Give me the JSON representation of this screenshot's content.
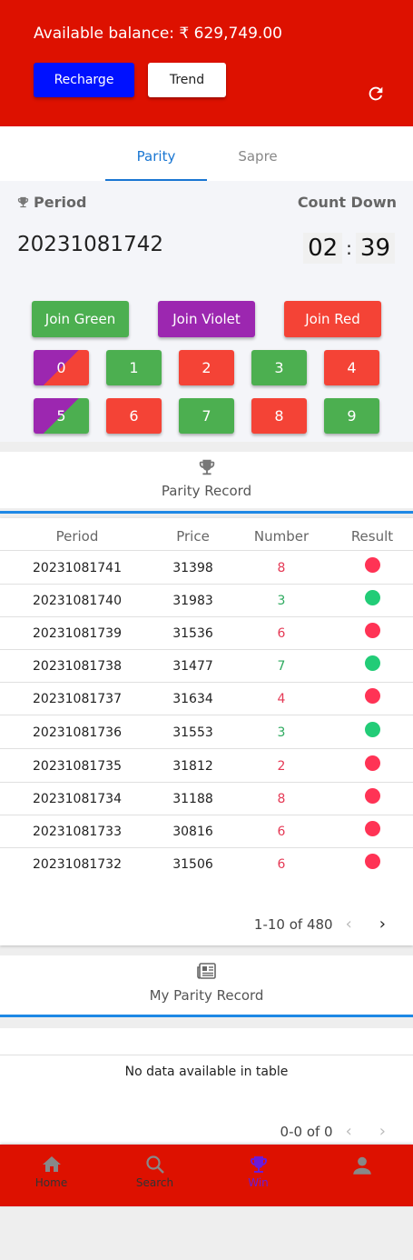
{
  "header": {
    "balance_label": "Available balance: ₹ 629,749.00",
    "recharge_label": "Recharge",
    "trend_label": "Trend"
  },
  "tabs": [
    {
      "label": "Parity",
      "active": true
    },
    {
      "label": "Sapre",
      "active": false
    }
  ],
  "game": {
    "period_label": "Period",
    "countdown_label": "Count Down",
    "period_number": "20231081742",
    "timer": {
      "minutes": "02",
      "seconds": "39",
      "sep": ":"
    },
    "join_green": "Join Green",
    "join_violet": "Join Violet",
    "join_red": "Join Red",
    "numbers": [
      "0",
      "1",
      "2",
      "3",
      "4",
      "5",
      "6",
      "7",
      "8",
      "9"
    ]
  },
  "parity_record": {
    "title": "Parity Record",
    "columns": [
      "Period",
      "Price",
      "Number",
      "Result"
    ],
    "rows": [
      {
        "period": "20231081741",
        "price": "31398",
        "number": "8",
        "result": "red"
      },
      {
        "period": "20231081740",
        "price": "31983",
        "number": "3",
        "result": "green"
      },
      {
        "period": "20231081739",
        "price": "31536",
        "number": "6",
        "result": "red"
      },
      {
        "period": "20231081738",
        "price": "31477",
        "number": "7",
        "result": "green"
      },
      {
        "period": "20231081737",
        "price": "31634",
        "number": "4",
        "result": "red"
      },
      {
        "period": "20231081736",
        "price": "31553",
        "number": "3",
        "result": "green"
      },
      {
        "period": "20231081735",
        "price": "31812",
        "number": "2",
        "result": "red"
      },
      {
        "period": "20231081734",
        "price": "31188",
        "number": "8",
        "result": "red"
      },
      {
        "period": "20231081733",
        "price": "30816",
        "number": "6",
        "result": "red"
      },
      {
        "period": "20231081732",
        "price": "31506",
        "number": "6",
        "result": "red"
      }
    ],
    "pagination": "1-10 of 480"
  },
  "my_record": {
    "title": "My Parity Record",
    "empty_text": "No data available in table",
    "pagination": "0-0 of 0"
  },
  "nav": [
    {
      "label": "Home",
      "icon": "home-icon"
    },
    {
      "label": "Search",
      "icon": "search-icon"
    },
    {
      "label": "Win",
      "icon": "trophy-icon",
      "active": true
    },
    {
      "label": "",
      "icon": "person-icon"
    }
  ],
  "colors": {
    "brand_red": "#dd1100",
    "recharge_blue": "#0011ff",
    "green": "#4caf50",
    "violet": "#9c27b0",
    "red": "#f44336",
    "tab_active": "#1976d2",
    "nav_active": "#6b1bd8"
  }
}
